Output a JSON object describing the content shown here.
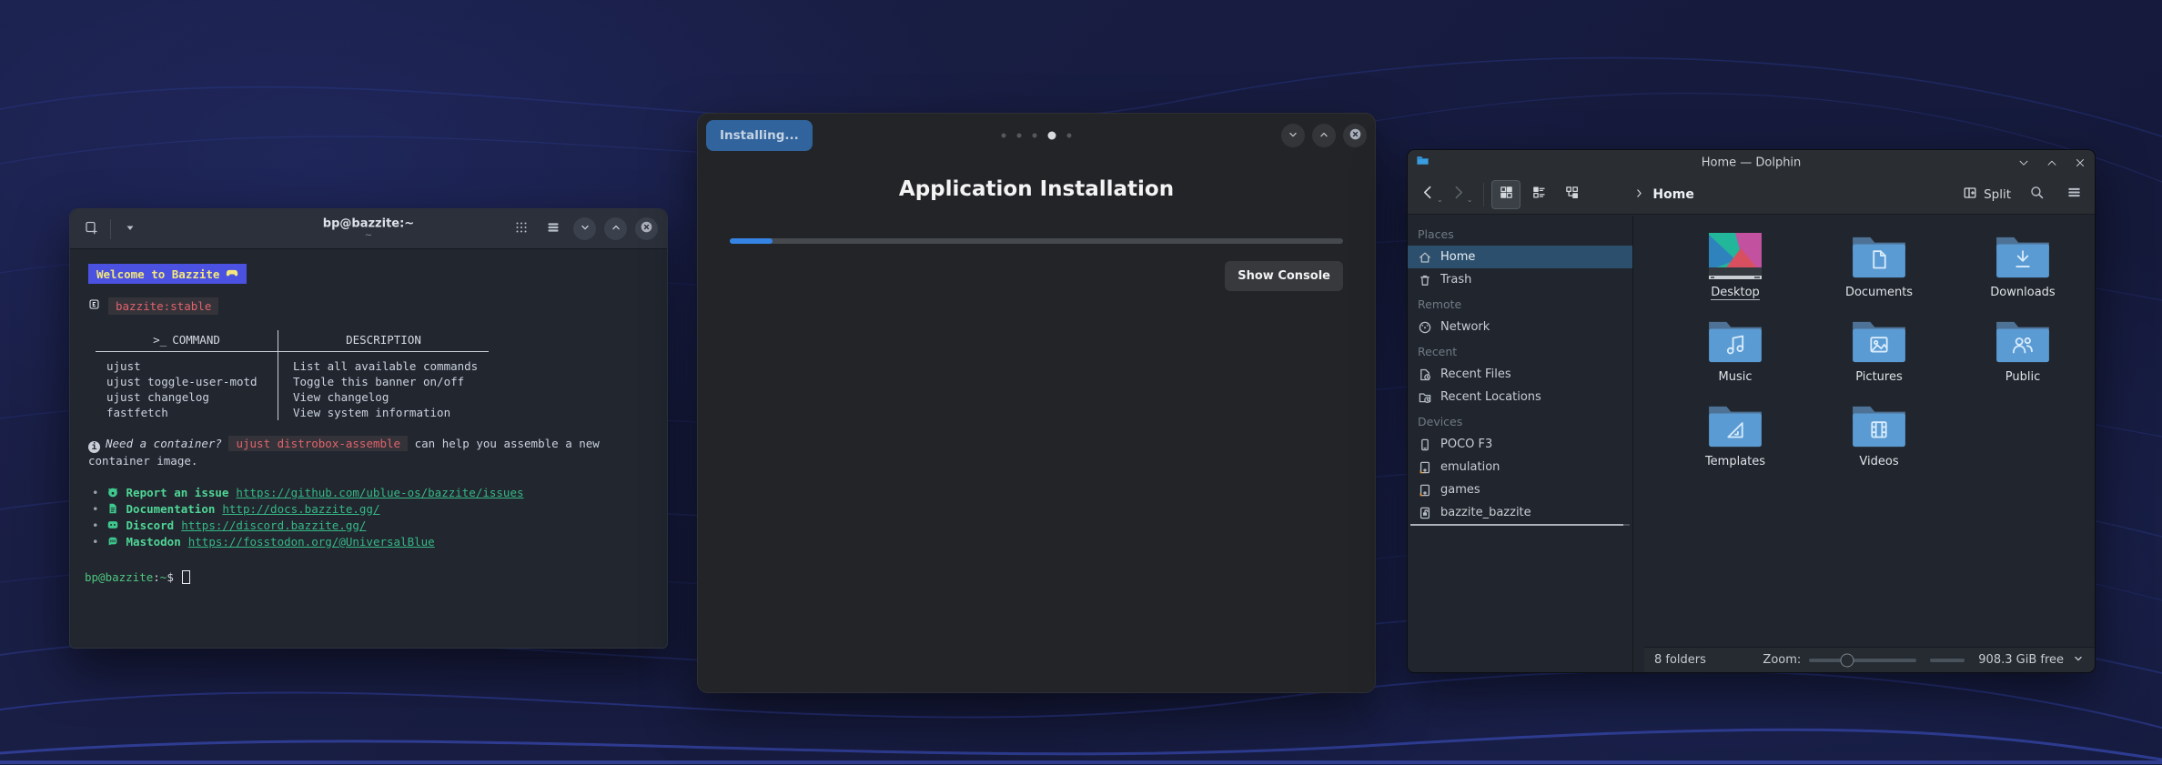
{
  "terminal": {
    "title": "bp@bazzite:~",
    "subtitle": "~",
    "banner_text": "Welcome to Bazzite",
    "image_tag": "bazzite:stable",
    "table": {
      "headers": [
        "COMMAND",
        "DESCRIPTION"
      ],
      "rows": [
        [
          "ujust",
          "List all available commands"
        ],
        [
          "ujust toggle-user-motd",
          "Toggle this banner on/off"
        ],
        [
          "ujust changelog",
          "View changelog"
        ],
        [
          "fastfetch",
          "View system information"
        ]
      ]
    },
    "info": {
      "prefix": "Need a container?",
      "code": "ujust distrobox-assemble",
      "suffix": "can help you assemble a new container image."
    },
    "links": [
      {
        "icon": "github-icon",
        "label": "Report an issue",
        "url": "https://github.com/ublue-os/bazzite/issues"
      },
      {
        "icon": "document-icon",
        "label": "Documentation",
        "url": "http://docs.bazzite.gg/"
      },
      {
        "icon": "discord-icon",
        "label": "Discord",
        "url": "https://discord.bazzite.gg/"
      },
      {
        "icon": "mastodon-icon",
        "label": "Mastodon",
        "url": "https://fosstodon.org/@UniversalBlue"
      }
    ],
    "prompt": {
      "user": "bp@bazzite",
      "separator": ":",
      "path": "~",
      "symbol": "$"
    }
  },
  "installer": {
    "titlebar_button": "Installing...",
    "page_dots": {
      "count": 5,
      "active_index": 3
    },
    "title": "Application Installation",
    "progress_percent": 7,
    "show_console_label": "Show Console"
  },
  "dolphin": {
    "window_title": "Home — Dolphin",
    "breadcrumb": "Home",
    "split_label": "Split",
    "sidebar": {
      "sections": [
        {
          "title": "Places",
          "items": [
            {
              "label": "Home",
              "icon": "home-icon",
              "selected": true
            },
            {
              "label": "Trash",
              "icon": "trash-icon"
            }
          ]
        },
        {
          "title": "Remote",
          "items": [
            {
              "label": "Network",
              "icon": "network-icon"
            }
          ]
        },
        {
          "title": "Recent",
          "items": [
            {
              "label": "Recent Files",
              "icon": "recent-files-icon"
            },
            {
              "label": "Recent Locations",
              "icon": "recent-locations-icon"
            }
          ]
        },
        {
          "title": "Devices",
          "items": [
            {
              "label": "POCO F3",
              "icon": "phone-icon"
            },
            {
              "label": "emulation",
              "icon": "drive-icon"
            },
            {
              "label": "games",
              "icon": "drive-icon"
            },
            {
              "label": "bazzite_bazzite",
              "icon": "drive-system-icon",
              "usage_bar": true
            }
          ]
        }
      ]
    },
    "folders": [
      {
        "name": "Desktop",
        "icon": "desktop-preview",
        "underlined": true
      },
      {
        "name": "Documents",
        "icon": "document"
      },
      {
        "name": "Downloads",
        "icon": "download"
      },
      {
        "name": "Music",
        "icon": "music"
      },
      {
        "name": "Pictures",
        "icon": "picture"
      },
      {
        "name": "Public",
        "icon": "public"
      },
      {
        "name": "Templates",
        "icon": "template"
      },
      {
        "name": "Videos",
        "icon": "video"
      }
    ],
    "statusbar": {
      "folders_text": "8 folders",
      "zoom_label": "Zoom:",
      "zoom_slider_percent": 35,
      "free_space_text": "908.3 GiB free"
    }
  },
  "colors": {
    "banner_bg": "#4b51e0",
    "banner_text": "#f4e87c",
    "tag_red": "#e0636b",
    "link_green": "#3ec98e",
    "progress_blue": "#3584e4",
    "folder_blue": "#5b9bd3",
    "selection_blue": "#2c4f6d"
  }
}
